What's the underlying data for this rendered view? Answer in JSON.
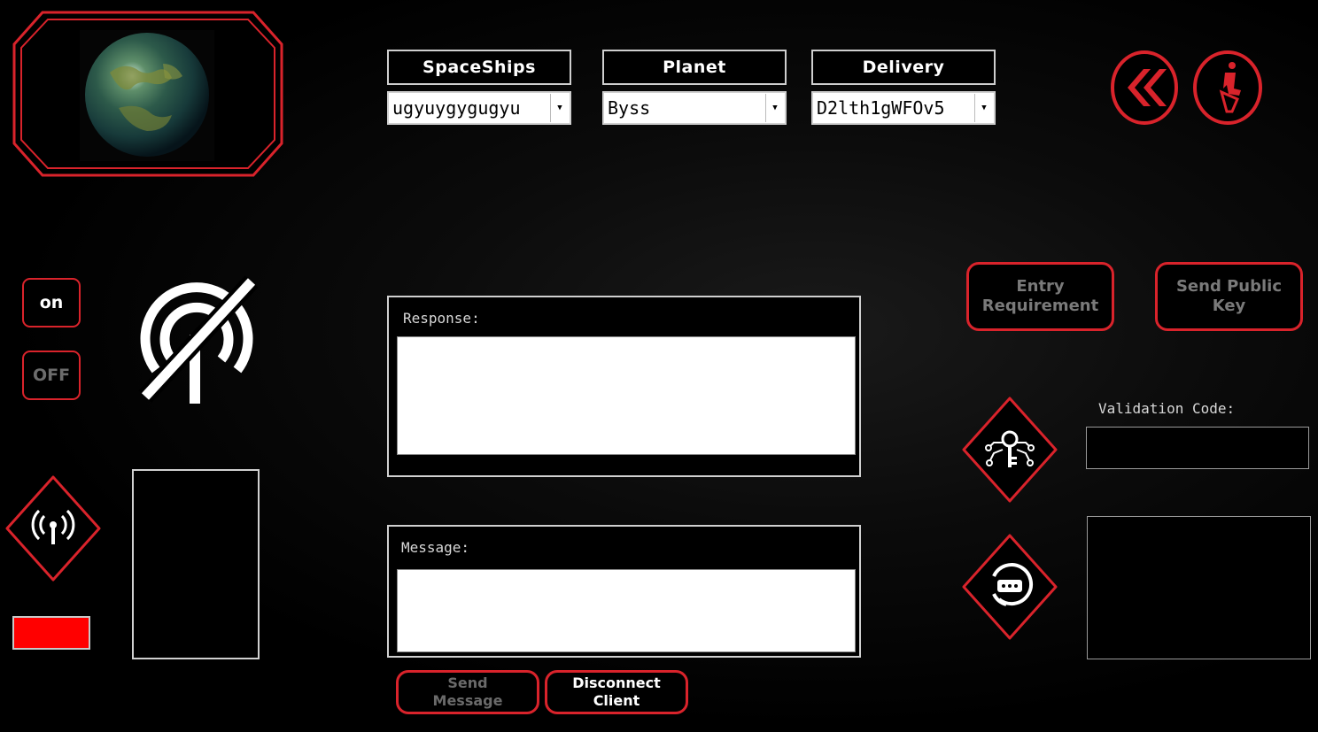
{
  "selectors": [
    {
      "label": "SpaceShips",
      "value": "ugyuygygugyu"
    },
    {
      "label": "Planet",
      "value": "Byss"
    },
    {
      "label": "Delivery",
      "value": "D2lth1gWFOv5"
    }
  ],
  "controls": {
    "on_label": "on",
    "off_label": "OFF"
  },
  "right_buttons": {
    "entry_requirement": "Entry Requirement",
    "send_public_key": "Send Public Key"
  },
  "response_panel": {
    "label": "Response:",
    "value": ""
  },
  "message_panel": {
    "label": "Message:",
    "value": ""
  },
  "bottom_buttons": {
    "send_message": "Send Message",
    "disconnect_client": "Disconnect Client"
  },
  "validation": {
    "label": "Validation Code:",
    "value": ""
  },
  "colors": {
    "accent": "#d9232b",
    "status_indicator": "#ff0000",
    "background": "#000000"
  },
  "icons": [
    "planet-image",
    "back-double-chevron-icon",
    "person-seated-icon",
    "no-signal-icon",
    "antenna-broadcast-icon",
    "key-circuit-icon",
    "chat-bubble-icon"
  ]
}
